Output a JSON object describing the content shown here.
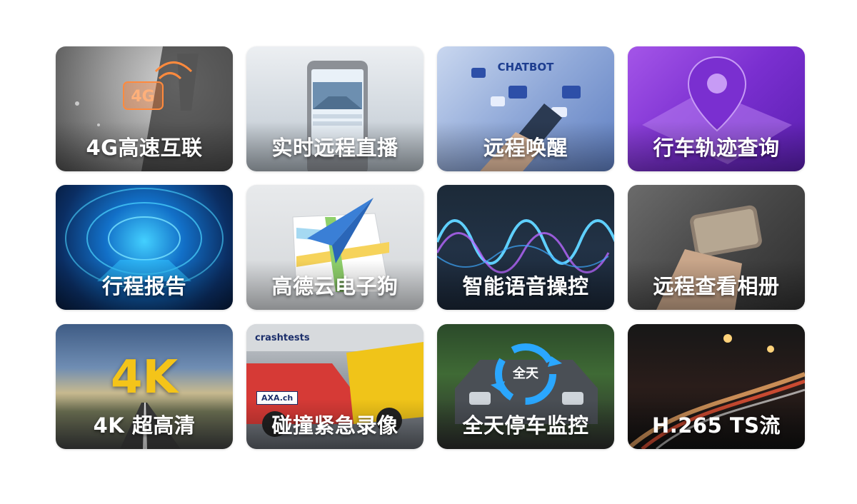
{
  "tiles": [
    {
      "label": "4G高速互联",
      "icon": "4g-signal-icon"
    },
    {
      "label": "实时远程直播",
      "icon": "phone-live-icon"
    },
    {
      "label": "远程唤醒",
      "icon": "chatbot-icon",
      "art_text": "CHATBOT"
    },
    {
      "label": "行车轨迹查询",
      "icon": "location-pin-icon"
    },
    {
      "label": "行程报告",
      "icon": "tunnel-icon"
    },
    {
      "label": "高德云电子狗",
      "icon": "paper-plane-map-icon"
    },
    {
      "label": "智能语音操控",
      "icon": "sound-wave-icon"
    },
    {
      "label": "远程查看相册",
      "icon": "phone-hand-icon"
    },
    {
      "label": "4K 超高清",
      "icon": "road-4k-icon",
      "art_text": "4K"
    },
    {
      "label": "碰撞紧急录像",
      "icon": "car-crash-icon",
      "art_text": "crashtests",
      "art_badge": "AXA.ch"
    },
    {
      "label": "全天停车监控",
      "icon": "parked-car-cycle-icon",
      "art_text": "全天"
    },
    {
      "label": "H.265 TS流",
      "icon": "night-traffic-icon"
    }
  ]
}
